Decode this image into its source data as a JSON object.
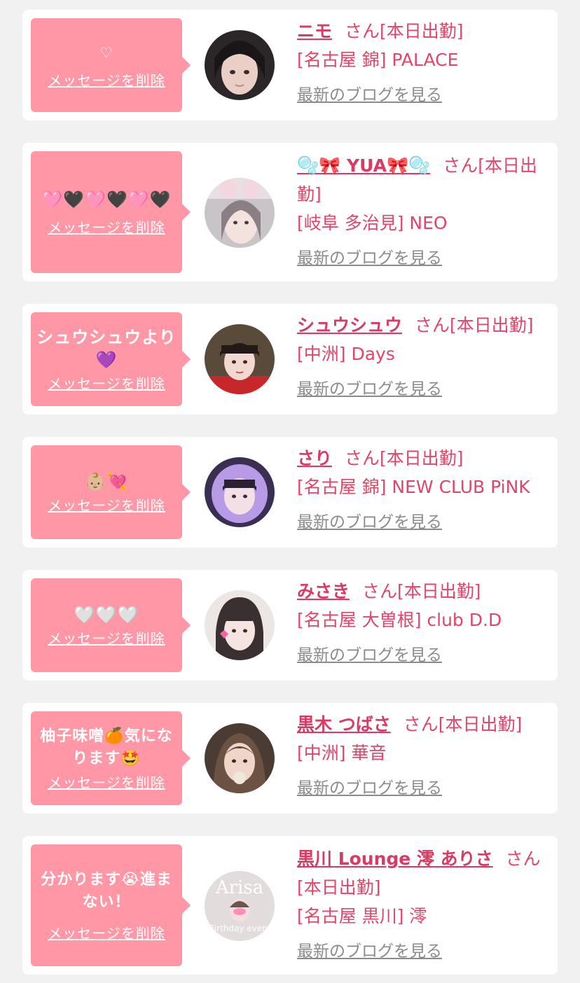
{
  "favorites": [
    {
      "message": "♡",
      "delete_label": "メッセージを削除",
      "name": "ニモ",
      "honorific": "さん",
      "status": "[本日出勤]",
      "store": "[名古屋 錦] PALACE",
      "blog_label": "最新のブログを見る"
    },
    {
      "message": "🩷🖤🩷🖤🩷🖤",
      "delete_label": "メッセージを削除",
      "name": "🫧🎀 YUA🎀🫧",
      "honorific": "さん",
      "status": "[本日出勤]",
      "store": "[岐阜 多治見] NEO",
      "blog_label": "最新のブログを見る"
    },
    {
      "message": "シュウシュウより\n💜",
      "delete_label": "メッセージを削除",
      "name": "シュウシュウ",
      "honorific": "さん",
      "status": "[本日出勤]",
      "store": "[中洲] Days",
      "blog_label": "最新のブログを見る"
    },
    {
      "message": "👶🏼💘",
      "delete_label": "メッセージを削除",
      "name": "さり",
      "honorific": "さん",
      "status": "[本日出勤]",
      "store": "[名古屋 錦] NEW CLUB PiNK",
      "blog_label": "最新のブログを見る"
    },
    {
      "message": "🤍🤍🤍",
      "delete_label": "メッセージを削除",
      "name": "みさき",
      "honorific": "さん",
      "status": "[本日出勤]",
      "store": "[名古屋 大曽根] club D.D",
      "blog_label": "最新のブログを見る"
    },
    {
      "message": "柚子味噌🍊気にな\nります🤩",
      "delete_label": "メッセージを削除",
      "name": "黒木 つばさ",
      "honorific": "さん",
      "status": "[本日出勤]",
      "store": "[中洲] 華音",
      "blog_label": "最新のブログを見る"
    },
    {
      "message": "分かります😭進ま\nない！",
      "delete_label": "メッセージを削除",
      "name": "黒川 Lounge 澪 ありさ",
      "honorific": "さん",
      "status": "[本日出勤]",
      "store": "[名古屋 黒川] 澪",
      "blog_label": "最新のブログを見る",
      "avatar_text": "Arisa",
      "avatar_subtext": "Birthday event"
    }
  ],
  "colors": {
    "bubble": "#ff97a6",
    "name": "#d83b63",
    "text": "#e0466a",
    "blog_link": "#8b8b8b",
    "background": "#f1f1f1"
  }
}
